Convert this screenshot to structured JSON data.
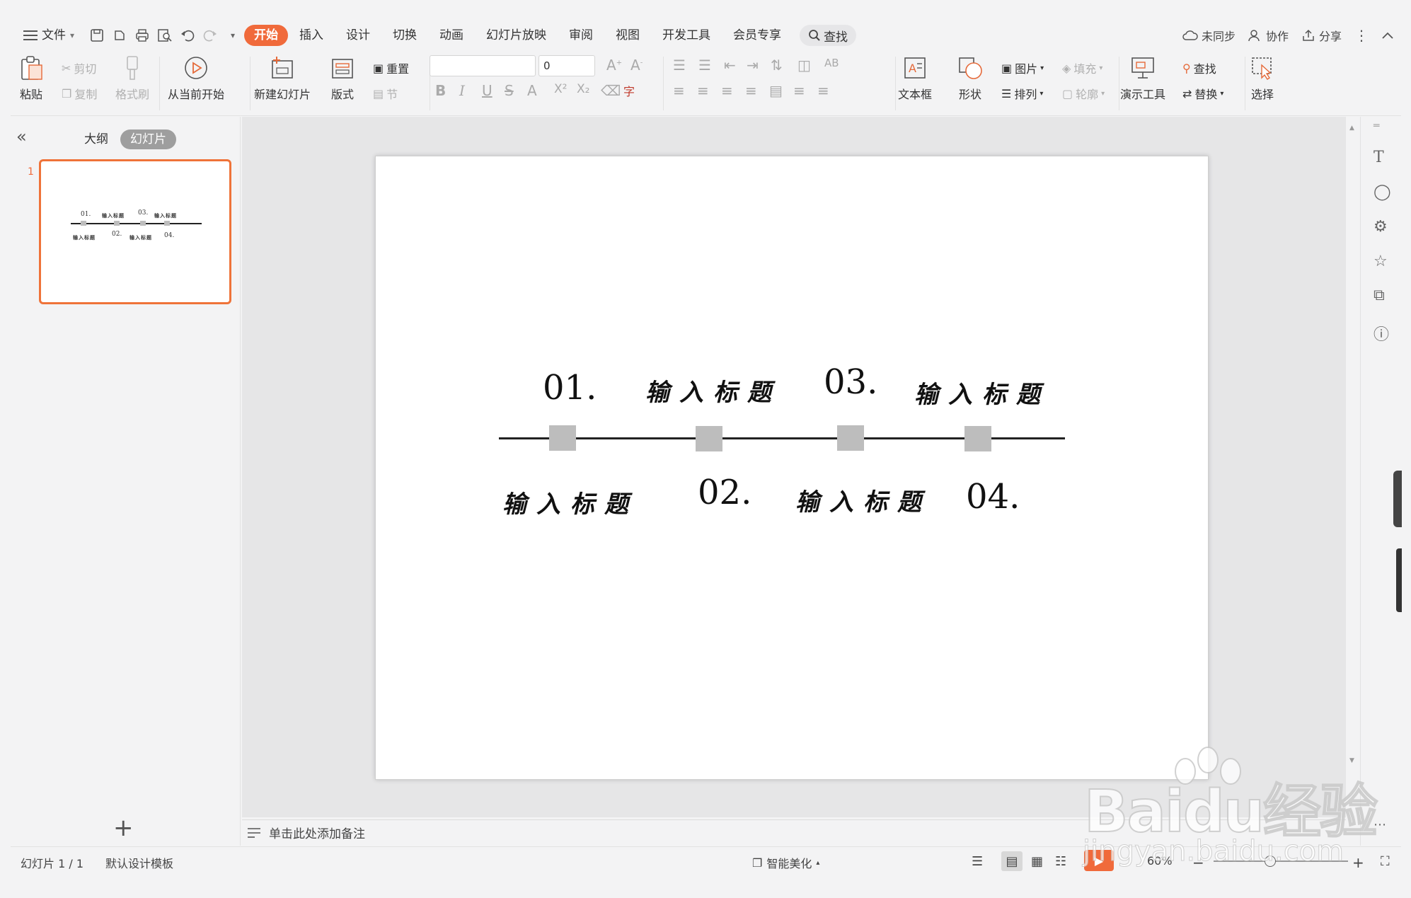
{
  "menubar": {
    "file_label": "文件",
    "tabs": [
      "开始",
      "插入",
      "设计",
      "切换",
      "动画",
      "幻灯片放映",
      "审阅",
      "视图",
      "开发工具",
      "会员专享"
    ],
    "active_tab": "开始",
    "search_label": "查找",
    "right": {
      "sync": "未同步",
      "collab": "协作",
      "share": "分享"
    }
  },
  "ribbon": {
    "paste": "粘贴",
    "cut": "剪切",
    "copy": "复制",
    "format_painter": "格式刷",
    "from_current": "从当前开始",
    "new_slide": "新建幻灯片",
    "layout": "版式",
    "reset": "重置",
    "section": "节",
    "font_name": "",
    "font_size": "0",
    "textbox": "文本框",
    "shape": "形状",
    "picture": "图片",
    "fill": "填充",
    "arrange": "排列",
    "outline": "轮廓",
    "presentation_tools": "演示工具",
    "find": "查找",
    "replace": "替换",
    "select": "选择"
  },
  "left_panel": {
    "tab_outline": "大纲",
    "tab_slides": "幻灯片",
    "thumb_number": "1"
  },
  "slide": {
    "items": [
      {
        "num": "01.",
        "title": "输入标题"
      },
      {
        "num": "02.",
        "title": "输入标题"
      },
      {
        "num": "03.",
        "title": "输入标题"
      },
      {
        "num": "04.",
        "title": "输入标题"
      }
    ]
  },
  "notes": {
    "placeholder": "单击此处添加备注"
  },
  "statusbar": {
    "slide_count": "幻灯片 1 / 1",
    "template": "默认设计模板",
    "beautify": "智能美化",
    "zoom": "60%"
  },
  "watermark": {
    "brand": "Baidu经验",
    "url": "jingyan.baidu.com"
  },
  "colors": {
    "accent": "#f06a3b",
    "thumb_border": "#ef7339",
    "square": "#bdbdbd"
  }
}
